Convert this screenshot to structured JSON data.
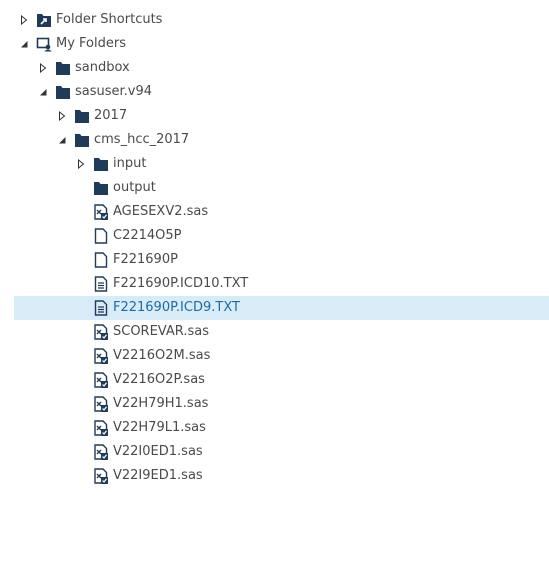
{
  "colors": {
    "text": "#4a4a4a",
    "icon": "#1e3c5a",
    "selected_bg": "#d8ecf8",
    "selected_text": "#1d6aa8"
  },
  "tree": {
    "folder_shortcuts": {
      "label": "Folder Shortcuts",
      "state": "collapsed",
      "icon": "shortcut-folder-icon"
    },
    "my_folders": {
      "label": "My Folders",
      "state": "expanded",
      "icon": "my-folders-icon"
    },
    "sandbox": {
      "label": "sandbox",
      "state": "collapsed",
      "icon": "folder-icon"
    },
    "sasuser": {
      "label": "sasuser.v94",
      "state": "expanded",
      "icon": "folder-icon"
    },
    "folder_2017": {
      "label": "2017",
      "state": "collapsed",
      "icon": "folder-icon"
    },
    "cms_hcc": {
      "label": "cms_hcc_2017",
      "state": "expanded",
      "icon": "folder-icon"
    },
    "input": {
      "label": "input",
      "state": "collapsed",
      "icon": "folder-icon"
    },
    "output": {
      "label": "output",
      "state": "leaf",
      "icon": "folder-icon"
    },
    "files": [
      {
        "label": "AGESEXV2.sas",
        "icon": "sas-program-icon",
        "selected": false
      },
      {
        "label": "C2214O5P",
        "icon": "blank-file-icon",
        "selected": false
      },
      {
        "label": "F221690P",
        "icon": "blank-file-icon",
        "selected": false
      },
      {
        "label": "F221690P.ICD10.TXT",
        "icon": "text-file-icon",
        "selected": false
      },
      {
        "label": "F221690P.ICD9.TXT",
        "icon": "text-file-icon",
        "selected": true
      },
      {
        "label": "SCOREVAR.sas",
        "icon": "sas-program-icon",
        "selected": false
      },
      {
        "label": "V2216O2M.sas",
        "icon": "sas-program-icon",
        "selected": false
      },
      {
        "label": "V2216O2P.sas",
        "icon": "sas-program-icon",
        "selected": false
      },
      {
        "label": "V22H79H1.sas",
        "icon": "sas-program-icon",
        "selected": false
      },
      {
        "label": "V22H79L1.sas",
        "icon": "sas-program-icon",
        "selected": false
      },
      {
        "label": "V22I0ED1.sas",
        "icon": "sas-program-icon",
        "selected": false
      },
      {
        "label": "V22I9ED1.sas",
        "icon": "sas-program-icon",
        "selected": false
      }
    ]
  }
}
